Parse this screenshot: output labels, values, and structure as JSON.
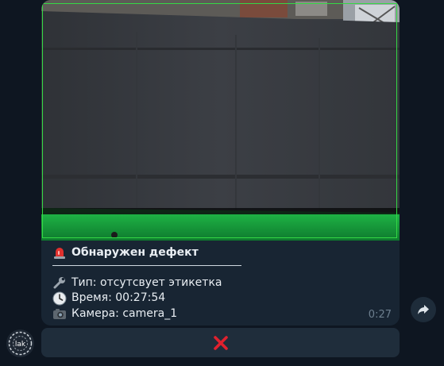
{
  "message": {
    "title": "Обнаружен дефект",
    "type_line": "Тип: отсутсвует этикетка",
    "time_line": "Время: 00:27:54",
    "camera_line": "Камера: camera_1",
    "timestamp": "0:27",
    "icons": {
      "title": "siren-icon",
      "type": "wrench-icon",
      "time": "clock-icon",
      "camera": "camera-icon"
    }
  },
  "keyboard": {
    "button_icon": "cross-mark-icon",
    "button_color": "#e0212e"
  },
  "avatar": {
    "label": "lak"
  },
  "colors": {
    "background": "#0e1621",
    "bubble": "#182533",
    "detection_box": "#35d845",
    "timestamp": "#6d7f8f"
  }
}
